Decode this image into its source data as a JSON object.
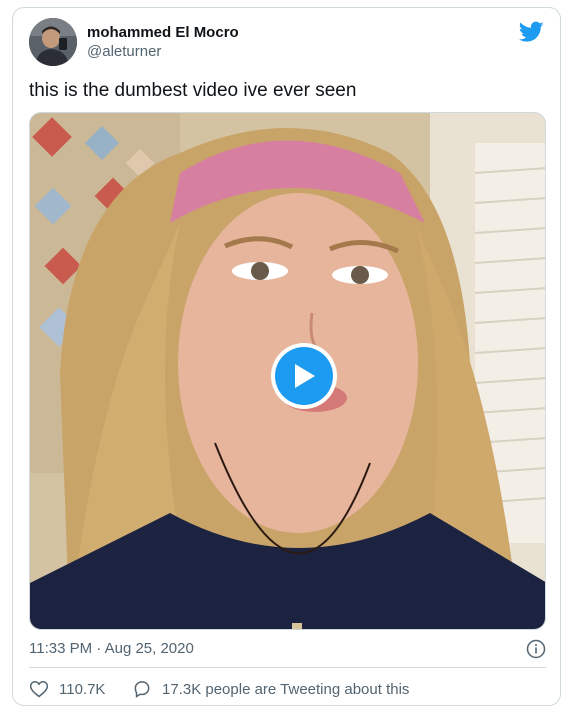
{
  "author": {
    "display_name": "mohammed El Mocro",
    "handle": "@aleturner"
  },
  "tweet": {
    "text": "this is the dumbest video ive ever seen",
    "timestamp": "11:33 PM · Aug 25, 2020"
  },
  "media": {
    "type": "video",
    "play_icon": "play-icon"
  },
  "actions": {
    "likes": "110.7K",
    "tweeting": "17.3K people are Tweeting about this"
  },
  "icons": {
    "brand": "twitter-bird-icon",
    "info": "info-icon",
    "like": "heart-icon",
    "reply": "speech-bubble-icon"
  },
  "colors": {
    "accent": "#1d9bf0",
    "secondary_text": "#536471",
    "border": "#cfd9de"
  }
}
